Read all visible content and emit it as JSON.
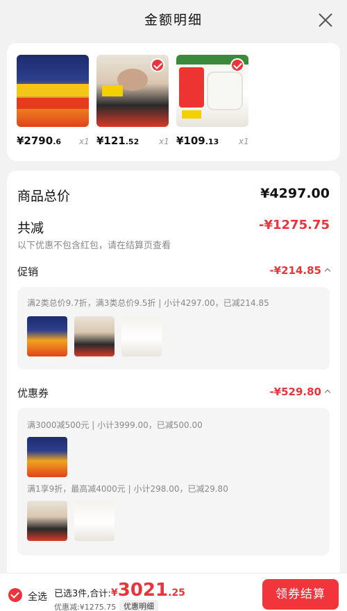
{
  "header": {
    "title": "金额明细"
  },
  "products": [
    {
      "price_int": "¥2790",
      "price_dec": ".6",
      "qty": "x1"
    },
    {
      "price_int": "¥121",
      "price_dec": ".52",
      "qty": "x1"
    },
    {
      "price_int": "¥109",
      "price_dec": ".13",
      "qty": "x1"
    }
  ],
  "summary": {
    "total_label": "商品总价",
    "total_value": "¥4297.00",
    "discount_label": "共减",
    "discount_value": "-¥1275.75",
    "discount_note": "以下优惠不包含红包，请在结算页查看"
  },
  "promotion": {
    "label": "促销",
    "value": "-¥214.85",
    "detail": "满2类总价9.7折，满3类总价9.5折 | 小计4297.00，已减214.85"
  },
  "coupon": {
    "label": "优惠券",
    "value": "-¥529.80",
    "detail1": "满3000减500元 | 小计3999.00，已减500.00",
    "detail2": "满1享9折，最高减4000元 | 小计298.00，已减29.80"
  },
  "bottom_bar": {
    "select_all": "全选",
    "selected_summary": "已选3件,合计:",
    "total_currency": "¥",
    "total_int": "3021",
    "total_dec": ".25",
    "discount_text": "优惠减:¥1275.75",
    "detail_button": "优惠明细",
    "pay_button": "领券结算"
  },
  "colors": {
    "accent": "#e8343a",
    "pay_button": "#f0363c"
  }
}
